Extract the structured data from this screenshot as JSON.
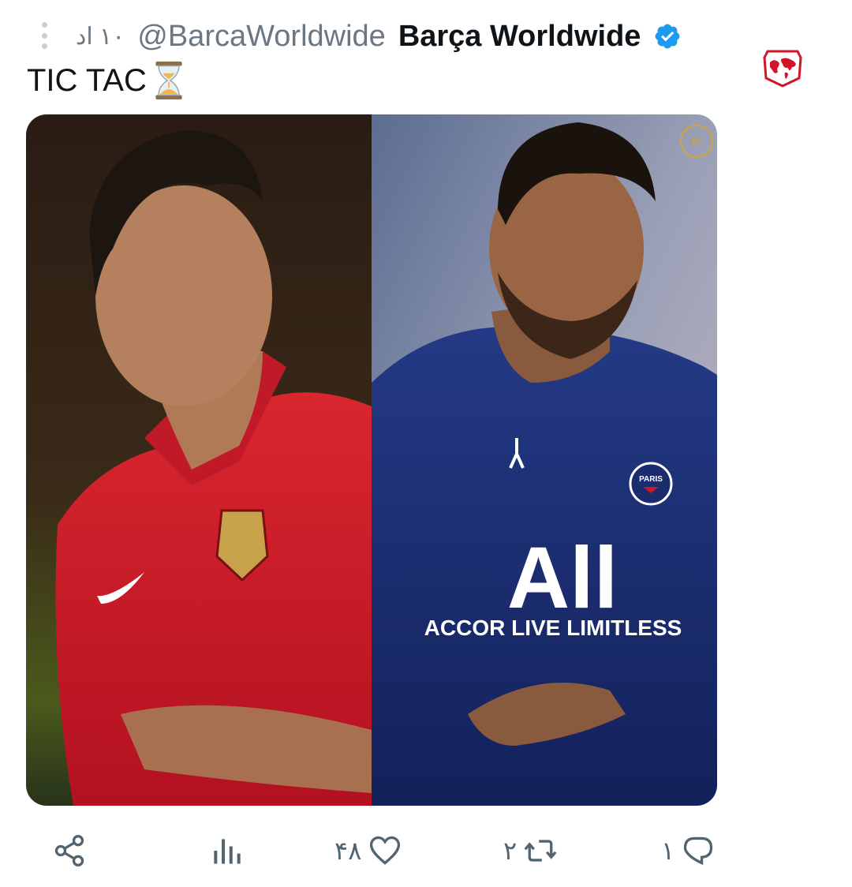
{
  "tweet": {
    "time": "۱۰ اد",
    "handle": "@BarcaWorldwide",
    "display_name": "Barça Worldwide",
    "text": "TIC TAC",
    "emoji_icon": "hourglass-icon"
  },
  "media": {
    "left_panel": {
      "description_icon": "player-red-shirt"
    },
    "right_panel": {
      "sponsor_logo": "All",
      "sponsor_text": "ACCOR LIVE LIMITLESS",
      "club_badge": "PARIS"
    }
  },
  "actions": {
    "reply_count": "۱",
    "retweet_count": "۲",
    "like_count": "۴۸",
    "views_icon": "bar-chart-icon",
    "share_icon": "share-icon"
  },
  "colors": {
    "text_primary": "#0f1419",
    "text_secondary": "#536471",
    "verified_blue": "#1d9bf0",
    "portugal_red": "#d2142a",
    "psg_navy": "#1a2c6e"
  }
}
